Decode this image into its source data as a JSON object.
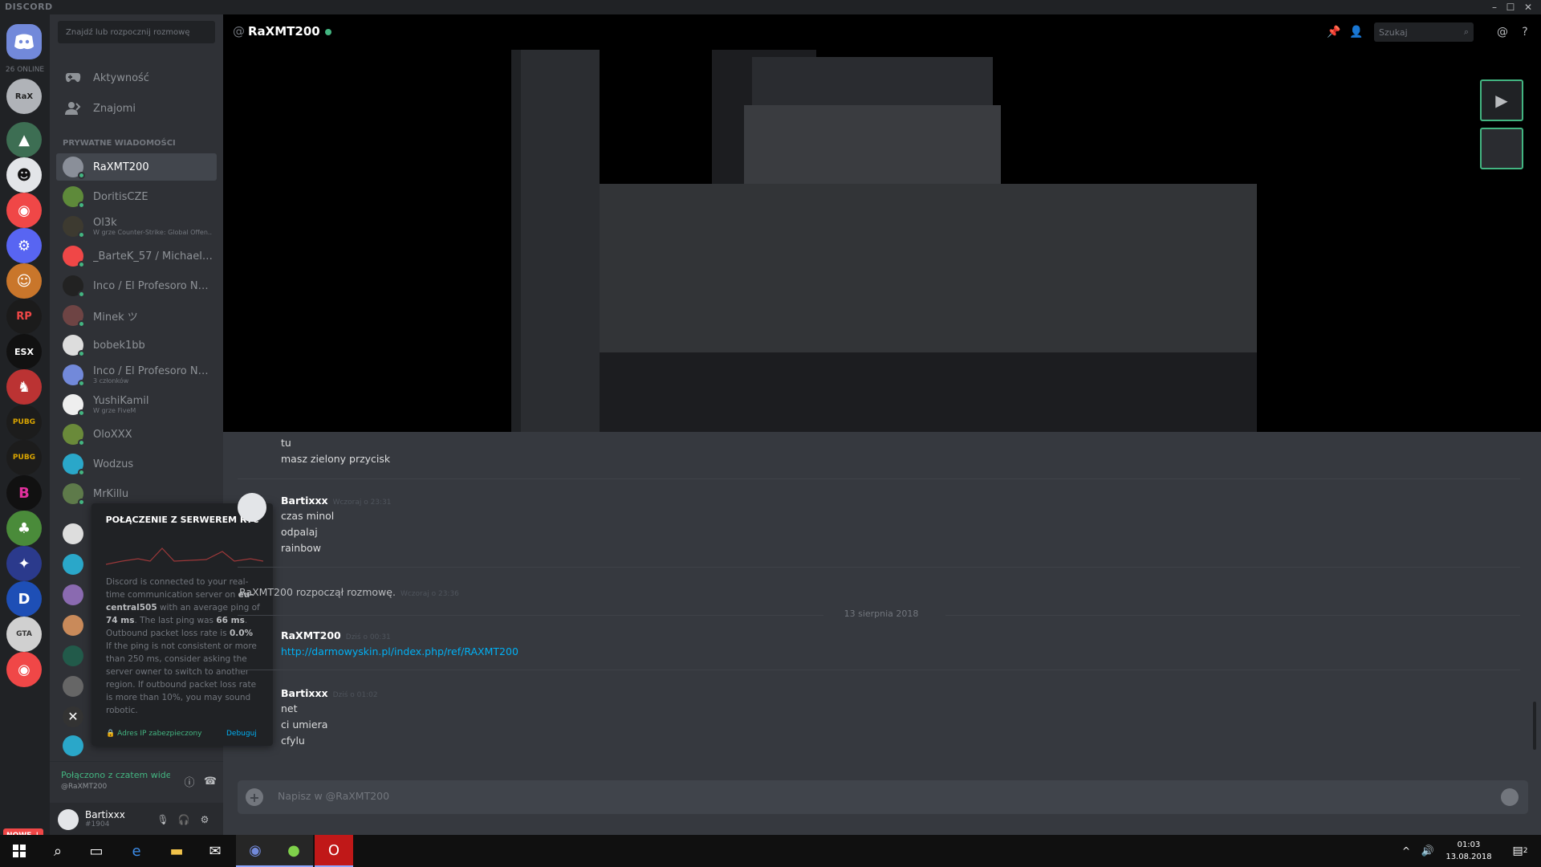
{
  "app": {
    "brand": "DISCORD",
    "online_count": "26 ONLINE",
    "new_badge": "NOWE ↓"
  },
  "window_controls": {
    "minimize": "–",
    "maximize": "☐",
    "close": "✕"
  },
  "sidebar": {
    "find_placeholder": "Znajdź lub rozpocznij rozmowę",
    "nav": [
      {
        "label": "Aktywność",
        "icon": "gamepad-icon"
      },
      {
        "label": "Znajomi",
        "icon": "friends-icon"
      }
    ],
    "pm_header": "PRYWATNE WIADOMOŚCI",
    "dms": [
      {
        "name": "RaXMT200",
        "sub": "",
        "active": true,
        "color": "#8a8f99"
      },
      {
        "name": "DoritisCZE",
        "sub": "",
        "color": "#5e8a3a"
      },
      {
        "name": "Ol3k",
        "sub": "W grze Counter-Strike: Global Offen..",
        "color": "#3d3a30"
      },
      {
        "name": "_BarteK_57 / Michael M...",
        "sub": "",
        "color": "#f04747"
      },
      {
        "name": "Inco / El Profesoro Narco",
        "sub": "",
        "color": "#222"
      },
      {
        "name": "Minek ツ",
        "sub": "",
        "color": "#6e4444"
      },
      {
        "name": "bobek1bb",
        "sub": "",
        "color": "#ddd"
      },
      {
        "name": "Inco / El Profesoro Narc...",
        "sub": "3 członków",
        "color": "#7289da"
      },
      {
        "name": "YushiKamil",
        "sub": "W grze FiveM",
        "color": "#eee"
      },
      {
        "name": "OloXXX",
        "sub": "",
        "color": "#6a8a3a"
      },
      {
        "name": "Wodzus",
        "sub": "",
        "color": "#2aa7c9"
      },
      {
        "name": "MrKillu",
        "sub": "",
        "color": "#5e7a4a"
      }
    ]
  },
  "rtc_popup": {
    "title": "POŁĄCZENIE Z SERWEREM RTC",
    "text1": "Discord is connected to your real-time communication server on",
    "server": "eu-central505",
    "text2": "with an average ping of",
    "avg_ping": "74 ms",
    "text3": ". The last ping was",
    "last_ping": "66 ms",
    "text4": ". Outbound packet loss rate is",
    "loss": "0.0%",
    "text5": "If the ping is not consistent or more than 250 ms, consider asking the server owner to switch to another region. If outbound packet loss rate is more than 10%, you may sound robotic.",
    "secure": "Adres IP zabezpieczony",
    "debug": "Debuguj"
  },
  "voice": {
    "status": "Połączono z czatem wideo",
    "channel": "@RaXMT200"
  },
  "user": {
    "name": "Bartixxx",
    "tag": "#1904"
  },
  "header": {
    "at": "@",
    "channel": "RaXMT200",
    "search_placeholder": "Szukaj"
  },
  "messages": {
    "m1_line1": "tu",
    "m1_line2": "masz zielony przycisk",
    "m2_author": "Bartixxx",
    "m2_ts": "Wczoraj o 23:31",
    "m2_lines": [
      "czas minol",
      "odpalaj",
      "rainbow"
    ],
    "system": "RaXMT200 rozpoczął rozmowę.",
    "system_ts": "Wczoraj o 23:36",
    "date_divider": "13 sierpnia 2018",
    "m3_author": "RaXMT200",
    "m3_ts": "Dziś o 00:31",
    "m3_link": "http://darmowyskin.pl/index.php/ref/RAXMT200",
    "m4_author": "Bartixxx",
    "m4_ts": "Dziś o 01:02",
    "m4_lines": [
      "net",
      "ci umiera",
      "cfylu"
    ]
  },
  "input": {
    "placeholder": "Napisz w @RaXMT200"
  },
  "taskbar": {
    "time": "01:03",
    "date": "13.08.2018",
    "notif": "2"
  }
}
